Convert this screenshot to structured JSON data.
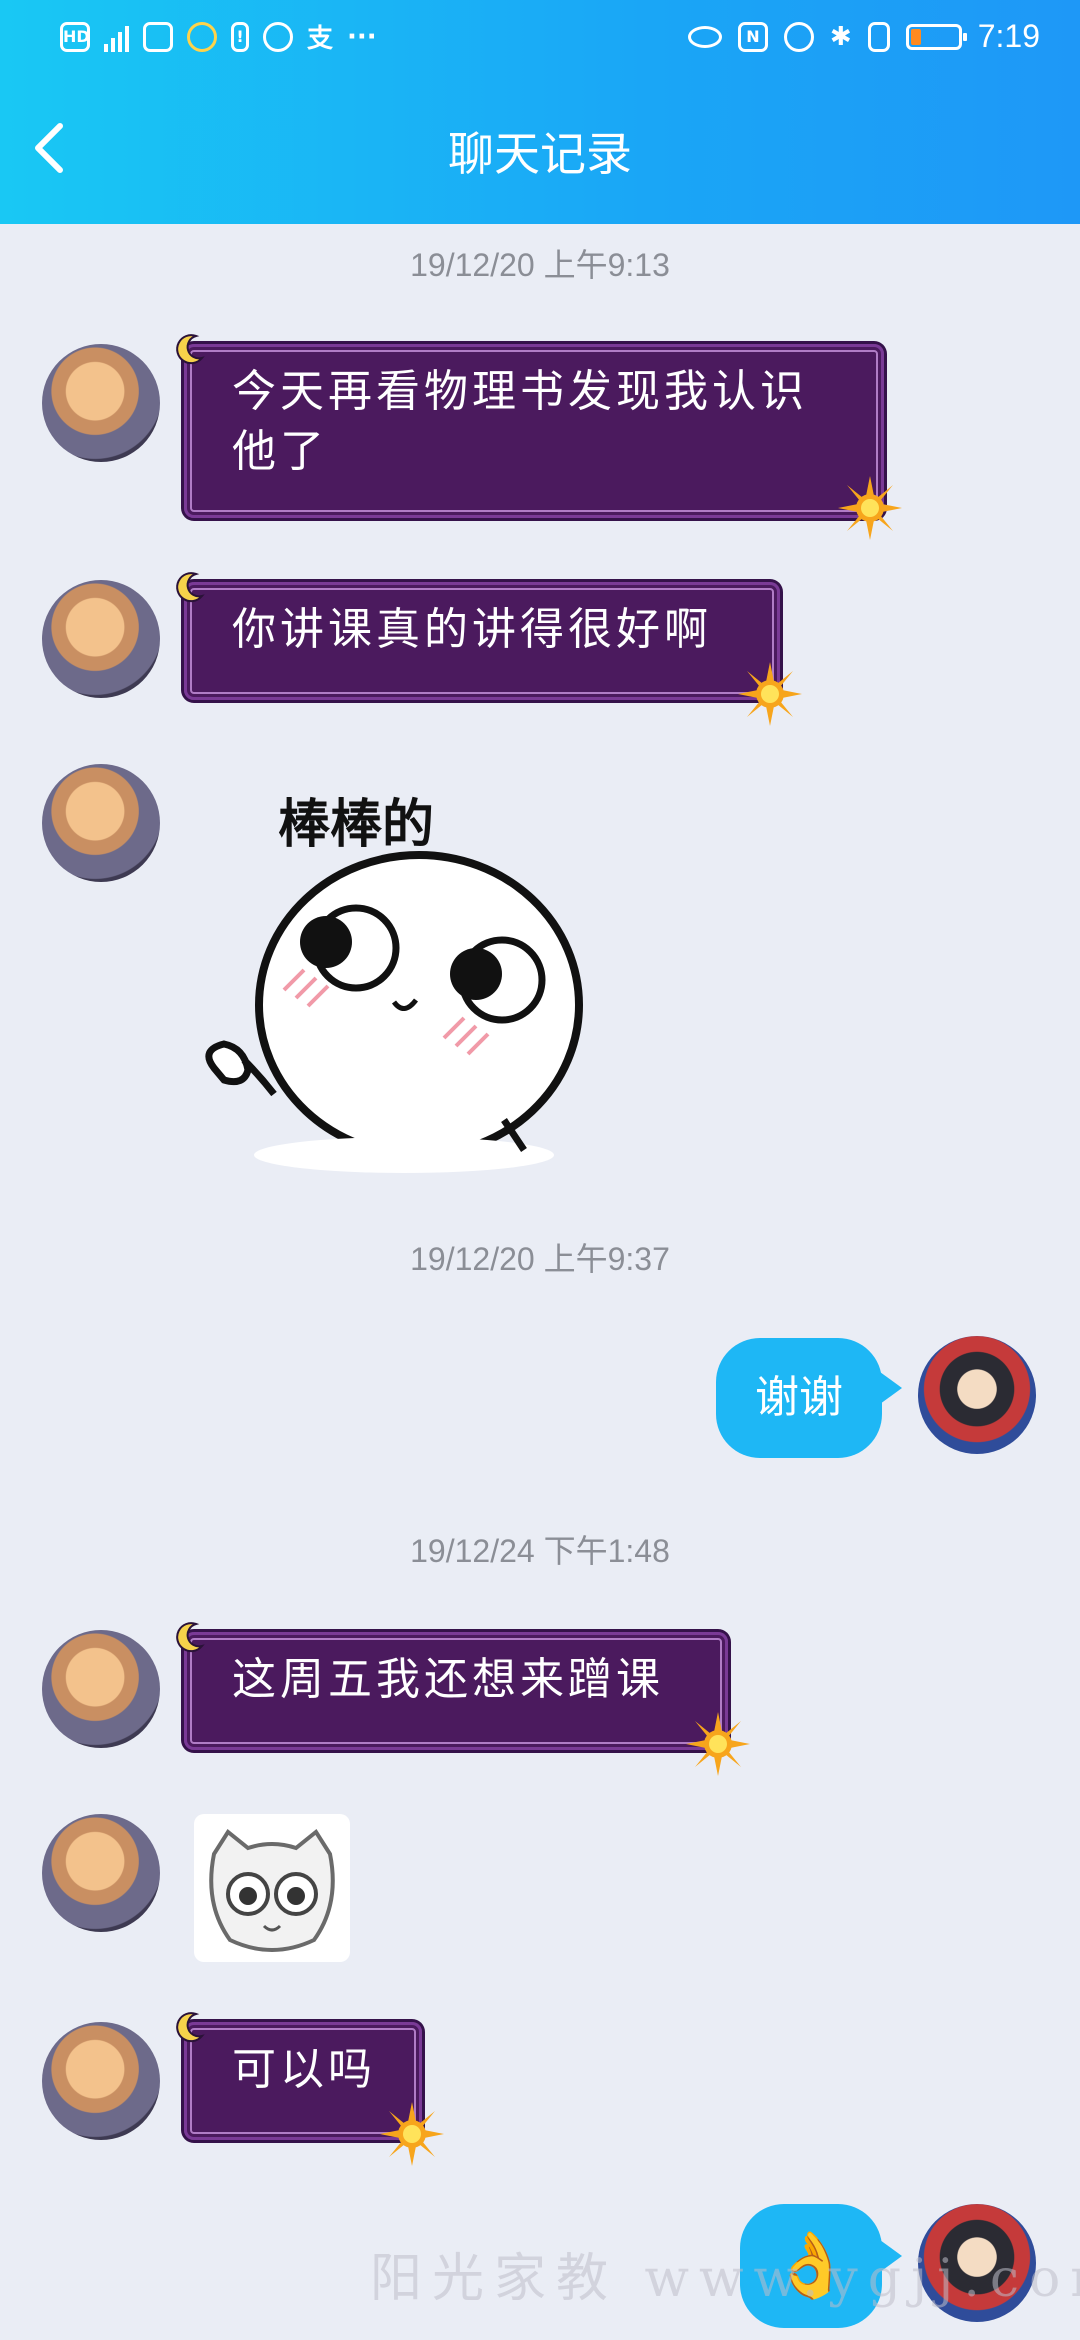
{
  "status_bar": {
    "left_items": [
      "HD",
      "4G",
      "alipay"
    ],
    "alipay_label": "支",
    "more": "···",
    "time": "7:19"
  },
  "header": {
    "title": "聊天记录",
    "back_icon": "chevron-left-icon"
  },
  "messages": [
    {
      "type": "timestamp",
      "text": "19/12/20 上午9:13"
    },
    {
      "type": "received",
      "text_line1": "今天再看物理书发现我认识",
      "text_line2": "他了"
    },
    {
      "type": "received",
      "text": "你讲课真的讲得很好啊"
    },
    {
      "type": "received_sticker",
      "caption": "棒棒的"
    },
    {
      "type": "timestamp",
      "text": "19/12/20 上午9:37"
    },
    {
      "type": "sent",
      "text": "谢谢"
    },
    {
      "type": "timestamp",
      "text": "19/12/24 下午1:48"
    },
    {
      "type": "received",
      "text": "这周五我还想来蹭课"
    },
    {
      "type": "received_image",
      "icon": "owl-sticker-icon"
    },
    {
      "type": "received",
      "text": "可以吗"
    },
    {
      "type": "sent_emoji",
      "emoji": "👌"
    }
  ],
  "watermark": "阳光家教 www.ygjj.com",
  "colors": {
    "header_start": "#19c8f4",
    "header_end": "#1e98f7",
    "background": "#eaedf5",
    "bubble_purple": "#4b1a5e",
    "bubble_blue": "#1eb7f5"
  }
}
